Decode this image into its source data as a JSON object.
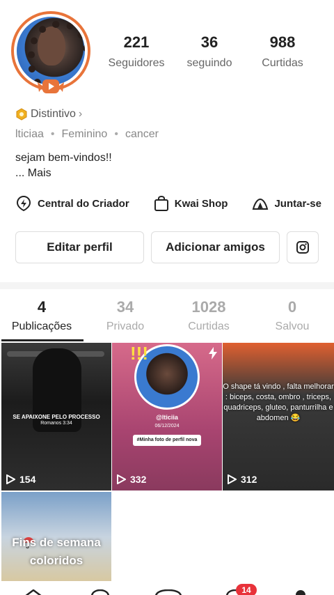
{
  "profile": {
    "stats": [
      {
        "num": "221",
        "label": "Seguidores"
      },
      {
        "num": "36",
        "label": "seguindo"
      },
      {
        "num": "988",
        "label": "Curtidas"
      }
    ],
    "badge_label": "Distintivo",
    "badge_chevron": "›",
    "tags": [
      "lticiaa",
      "Feminino",
      "cancer"
    ],
    "tag_separator": "•",
    "bio_line": "sejam bem-vindos!!",
    "bio_more": "... Mais"
  },
  "links": {
    "creator": "Central do Criador",
    "shop": "Kwai Shop",
    "join": "Juntar-se"
  },
  "buttons": {
    "edit": "Editar perfil",
    "add": "Adicionar amigos"
  },
  "tabs": [
    {
      "num": "4",
      "label": "Publicações"
    },
    {
      "num": "34",
      "label": "Privado"
    },
    {
      "num": "1028",
      "label": "Curtidas"
    },
    {
      "num": "0",
      "label": "Salvou"
    }
  ],
  "posts": [
    {
      "views": "154",
      "caption": "SE APAIXONE PELO PROCESSO",
      "caption2": "Romanos 3:34"
    },
    {
      "views": "332",
      "handle": "@lticiia",
      "date": "06/12/2024",
      "pill": "#Minha foto de perfil nova"
    },
    {
      "views": "312",
      "text": "O shape tá vindo , falta melhorar : biceps, costa, ombro , triceps, quadriceps, gluteo, panturrilha e abdomen 😂"
    },
    {
      "text": "Fins de semana coloridos"
    }
  ],
  "nav": {
    "badge": "14"
  },
  "colors": {
    "accent_ring": "#e8743a",
    "badge_red": "#e8323a"
  }
}
